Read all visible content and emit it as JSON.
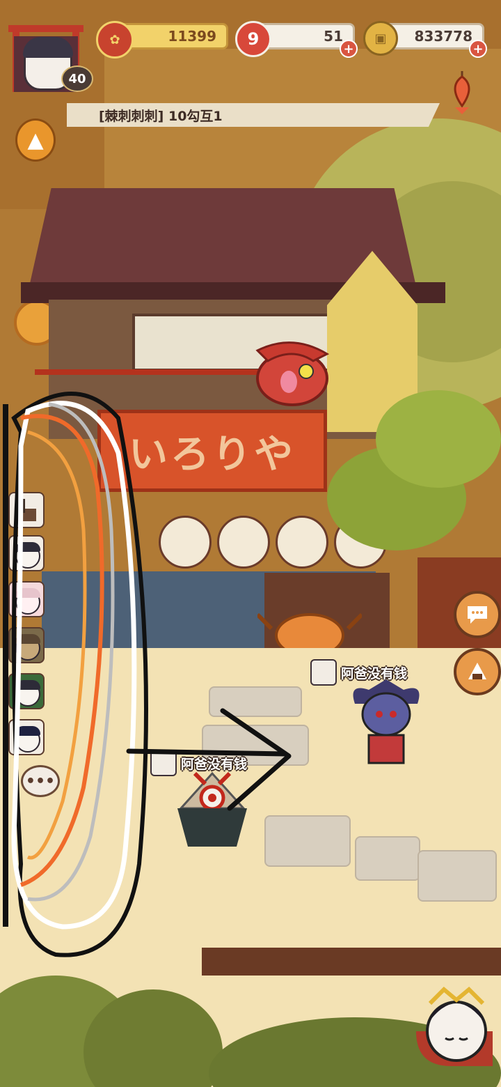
{
  "hud": {
    "player_level": "40",
    "currency_gold": "11399",
    "currency_magatama": "51",
    "currency_coins": "833778",
    "quest_text": "[棘刺刺刺] 10勾互1"
  },
  "shop_sign": "いろりや",
  "characters": [
    {
      "name_tag": "阿爸没有钱"
    },
    {
      "name_tag": "阿爸没有钱"
    }
  ],
  "sidebar": {
    "chat_more_label": "•••"
  },
  "colors": {
    "gold_pill": "#f2d26a",
    "plus_button": "#d95541",
    "banner": "#d8532a",
    "ground": "#f3e2b4"
  },
  "annotation_colors": [
    "#111111",
    "#ffffff",
    "#f06a2a",
    "#f2a040",
    "#bdbdbd"
  ]
}
